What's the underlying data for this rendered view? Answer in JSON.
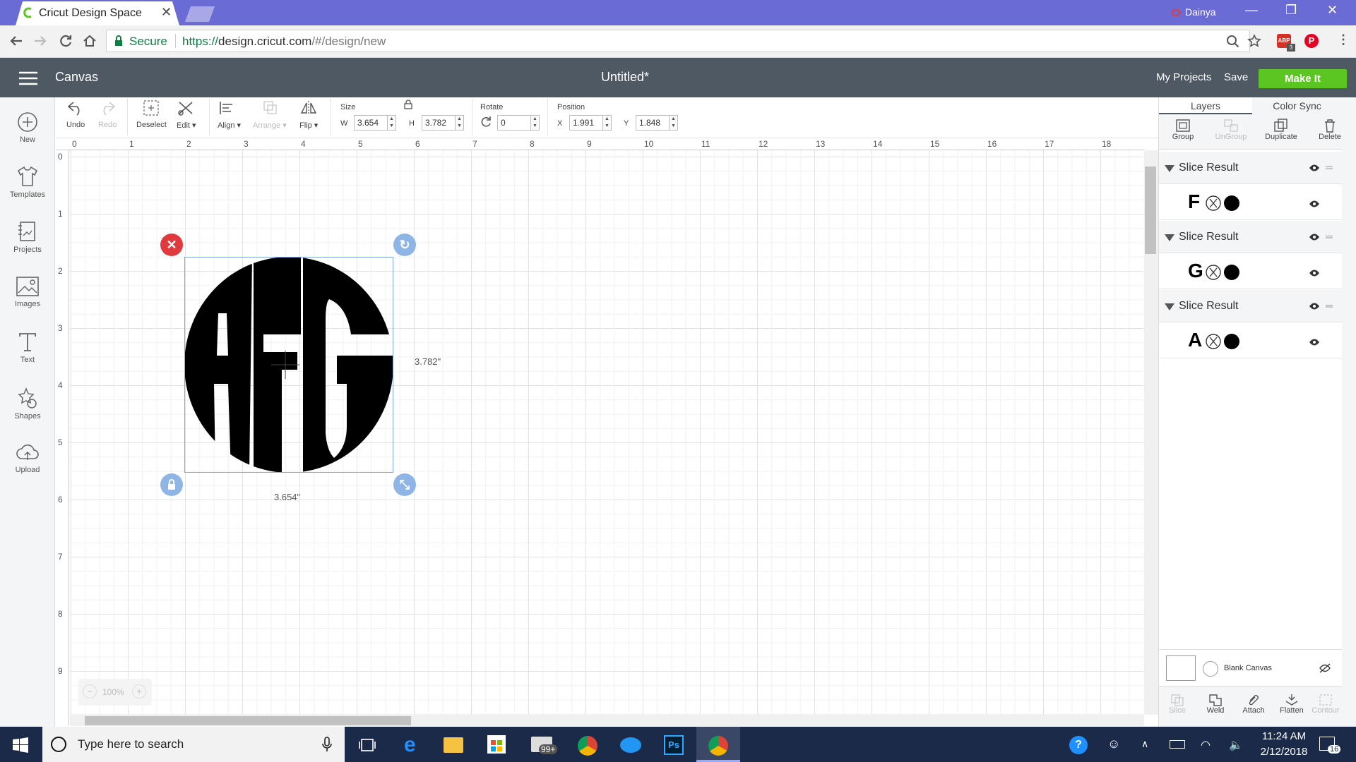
{
  "browser": {
    "tab_title": "Cricut Design Space",
    "tab_close": "✕",
    "profile_name": "Dainya",
    "secure_label": "Secure",
    "url_scheme": "https://",
    "url_host": "design.cricut.com",
    "url_path": "/#/design/new",
    "extension_badge": "3"
  },
  "app": {
    "section_title": "Canvas",
    "doc_title": "Untitled*",
    "my_projects": "My Projects",
    "save": "Save",
    "make_it": "Make It"
  },
  "sidebar": {
    "items": [
      {
        "label": "New",
        "icon": "plus-circle-icon"
      },
      {
        "label": "Templates",
        "icon": "shirt-icon"
      },
      {
        "label": "Projects",
        "icon": "projects-icon"
      },
      {
        "label": "Images",
        "icon": "image-icon"
      },
      {
        "label": "Text",
        "icon": "text-icon"
      },
      {
        "label": "Shapes",
        "icon": "shapes-icon"
      },
      {
        "label": "Upload",
        "icon": "upload-cloud-icon"
      }
    ]
  },
  "toolbar": {
    "undo": "Undo",
    "redo": "Redo",
    "deselect": "Deselect",
    "edit": "Edit",
    "align": "Align",
    "arrange": "Arrange",
    "flip": "Flip",
    "size_label": "Size",
    "w_label": "W",
    "w_value": "3.654",
    "h_label": "H",
    "h_value": "3.782",
    "rotate_label": "Rotate",
    "rotate_value": "0",
    "position_label": "Position",
    "x_label": "X",
    "x_value": "1.991",
    "y_label": "Y",
    "y_value": "1.848"
  },
  "rulers": {
    "top": [
      "0",
      "1",
      "2",
      "3",
      "4",
      "5",
      "6",
      "7",
      "8",
      "9",
      "10",
      "11",
      "12",
      "13",
      "14",
      "15",
      "16",
      "17",
      "18"
    ],
    "left": [
      "0",
      "1",
      "2",
      "3",
      "4",
      "5",
      "6",
      "7",
      "8",
      "9"
    ]
  },
  "canvas": {
    "monogram_text": "AFG",
    "height_dim": "3.782\"",
    "width_dim": "3.654\"",
    "zoom_level": "100%",
    "zoom_minus": "−",
    "zoom_plus": "+"
  },
  "layers_panel": {
    "tab_layers": "Layers",
    "tab_color_sync": "Color Sync",
    "actions": [
      {
        "label": "Group",
        "enabled": true
      },
      {
        "label": "UnGroup",
        "enabled": false
      },
      {
        "label": "Duplicate",
        "enabled": true
      },
      {
        "label": "Delete",
        "enabled": true
      }
    ],
    "groups": [
      {
        "title": "Slice Result",
        "glyph": "F"
      },
      {
        "title": "Slice Result",
        "glyph": "G"
      },
      {
        "title": "Slice Result",
        "glyph": "A"
      }
    ],
    "blank_canvas": "Blank Canvas",
    "bottom_actions": [
      {
        "label": "Slice",
        "enabled": false
      },
      {
        "label": "Weld",
        "enabled": true
      },
      {
        "label": "Attach",
        "enabled": true
      },
      {
        "label": "Flatten",
        "enabled": true
      },
      {
        "label": "Contour",
        "enabled": false
      }
    ]
  },
  "taskbar": {
    "search_placeholder": "Type here to search",
    "mail_badge": "99+",
    "time": "11:24 AM",
    "date": "2/12/2018",
    "notification_count": "16"
  },
  "colors": {
    "browser_frame": "#6b6bd6",
    "app_header": "#4e5963",
    "make_it_green": "#5bc522",
    "delete_handle": "#e03a3e",
    "handle_blue": "#8fb4e6",
    "taskbar": "#1c2a4a"
  }
}
